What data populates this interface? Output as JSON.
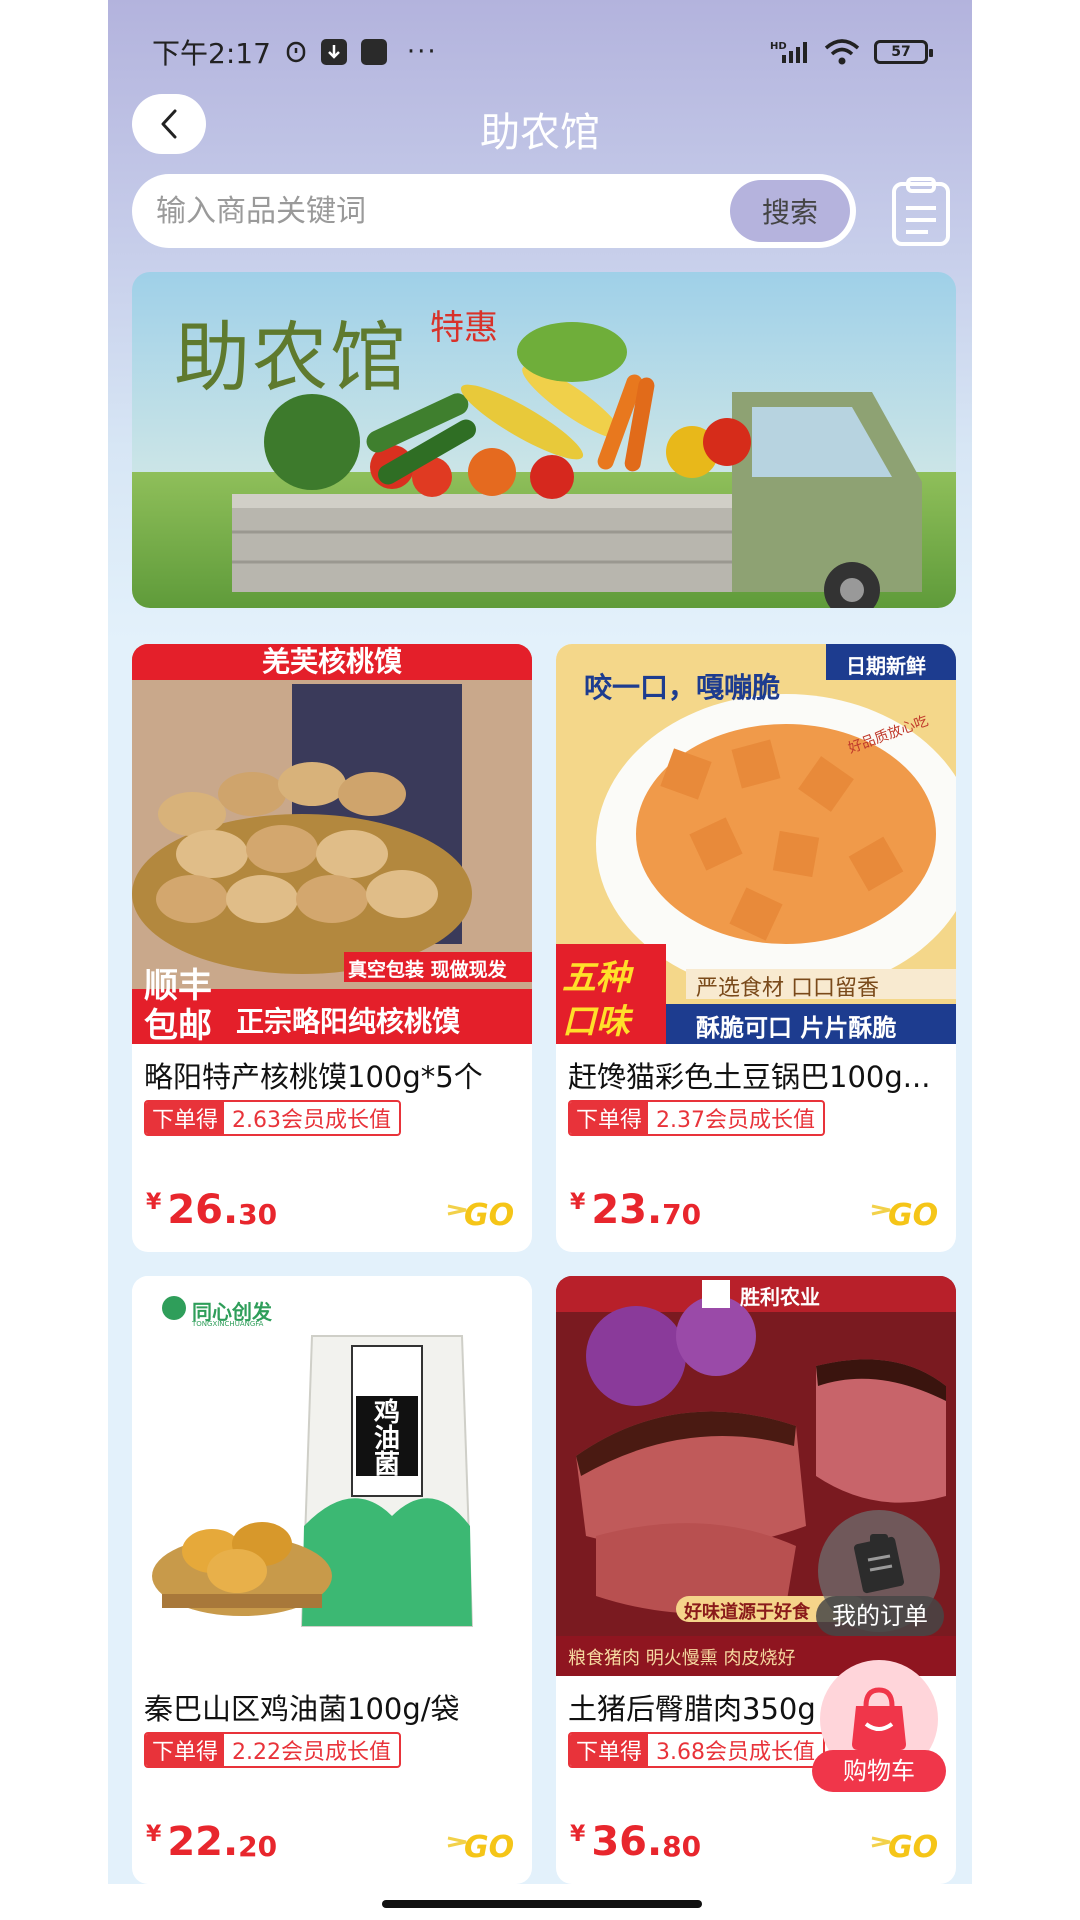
{
  "status_bar": {
    "time": "下午2:17",
    "battery": "57"
  },
  "header": {
    "title": "助农馆"
  },
  "search": {
    "placeholder": "输入商品关键词",
    "button": "搜索"
  },
  "banner": {
    "title": "助农馆",
    "subtitle": "特惠"
  },
  "products": [
    {
      "name": "略阳特产核桃馍100g*5个",
      "growth_tag": "下单得",
      "growth_value": "2.63会员成长值",
      "price_symbol": "¥",
      "price_int": "26.",
      "price_dec": "30",
      "image_texts": {
        "top": "羌芙核桃馍",
        "pack": "真空包装 现做现发",
        "corner1": "顺丰",
        "corner2": "包邮",
        "bottom": "正宗略阳纯核桃馍"
      }
    },
    {
      "name": "赶馋猫彩色土豆锅巴100g...",
      "growth_tag": "下单得",
      "growth_value": "2.37会员成长值",
      "price_symbol": "¥",
      "price_int": "23.",
      "price_dec": "70",
      "image_texts": {
        "corner": "日期新鲜",
        "headline": "咬一口，嘎嘣脆",
        "seal": "好品质放心吃",
        "flavor1": "五种",
        "flavor2": "口味",
        "line1": "严选食材 口口留香",
        "line2": "酥脆可口 片片酥脆"
      }
    },
    {
      "name": "秦巴山区鸡油菌100g/袋",
      "growth_tag": "下单得",
      "growth_value": "2.22会员成长值",
      "price_symbol": "¥",
      "price_int": "22.",
      "price_dec": "20",
      "image_texts": {
        "brand": "同心创发",
        "brand_en": "TONGXINCHUANGFA",
        "bag": "鸡油菌"
      }
    },
    {
      "name": "土猪后臀腊肉350g",
      "growth_tag": "下单得",
      "growth_value": "3.68会员成长值",
      "price_symbol": "¥",
      "price_int": "36.",
      "price_dec": "80",
      "image_texts": {
        "brand": "胜利农业",
        "ribbon": "好味道源于好食",
        "bottom": "粮食猪肉 明火慢熏 肉皮烧好"
      }
    }
  ],
  "floating": {
    "orders": "我的订单",
    "cart": "购物车"
  },
  "colors": {
    "price": "#e8262d",
    "header_gradient_top": "#b3b3dd",
    "cart": "#f0364a"
  }
}
